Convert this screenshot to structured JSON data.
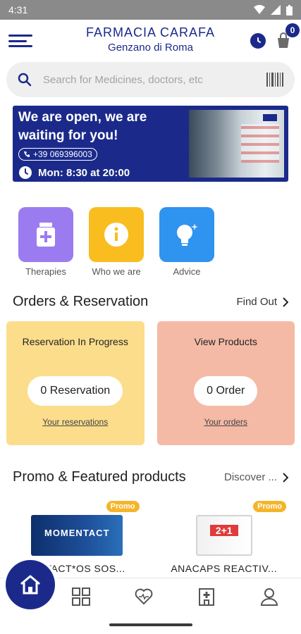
{
  "status": {
    "time": "4:31"
  },
  "header": {
    "pharmacy_name": "FARMACIA CARAFA",
    "city": "Genzano di Roma",
    "cart_count": "0"
  },
  "search": {
    "placeholder": "Search for Medicines, doctors, etc"
  },
  "banner": {
    "title": "We are open, we are waiting for you!",
    "phone": "+39 069396003",
    "hours": "Mon: 8:30 at 20:00"
  },
  "shortcuts": [
    {
      "label": "Therapies",
      "color": "#9b7cf0",
      "icon": "medicine-icon"
    },
    {
      "label": "Who we are",
      "color": "#f9bd1f",
      "icon": "info-icon"
    },
    {
      "label": "Advice",
      "color": "#2f93f0",
      "icon": "lightbulb-icon"
    }
  ],
  "orders_section": {
    "title": "Orders & Reservation",
    "link": "Find Out",
    "cards": [
      {
        "title": "Reservation In Progress",
        "count": "0 Reservation",
        "link": "Your reservations",
        "color": "#fbdd8c"
      },
      {
        "title": "View Products",
        "count": "0 Order",
        "link": "Your orders",
        "color": "#f4baa6"
      }
    ]
  },
  "promo_section": {
    "title": "Promo & Featured products",
    "link": "Discover ...",
    "products": [
      {
        "badge": "Promo",
        "name": "...NTACT*OS SOS...",
        "image_text": "MOMENTACT"
      },
      {
        "badge": "Promo",
        "name": "ANACAPS REACTIV...",
        "image_text": "2+1"
      }
    ]
  },
  "nav": [
    "home-icon",
    "categories-icon",
    "health-icon",
    "pharmacy-icon",
    "profile-icon"
  ],
  "colors": {
    "brand": "#1b2a8a"
  }
}
